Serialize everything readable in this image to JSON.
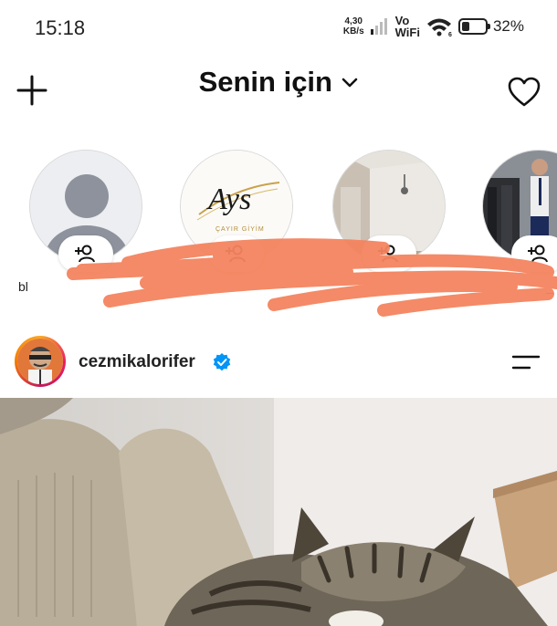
{
  "status_bar": {
    "time": "15:18",
    "net_speed_value": "4,30",
    "net_speed_unit": "KB/s",
    "wifi_line1": "Vo",
    "wifi_line2": "WiFi",
    "wifi_badge": "6",
    "battery_level": 0.32,
    "battery_pct": "32%"
  },
  "header": {
    "title": "Senin için",
    "icons": [
      "plus-icon",
      "chevron-down-icon",
      "heart-icon"
    ]
  },
  "suggestions": {
    "items": [
      {
        "avatar": "default-avatar",
        "name_visible": "bl"
      },
      {
        "avatar": "ays-logo",
        "logo_text": "Ays",
        "logo_subtext": "ÇAYIR GİYİM"
      },
      {
        "avatar": "room-photo"
      },
      {
        "avatar": "store-photo",
        "name_visible": "_"
      }
    ],
    "badge_icon": "add-person-icon"
  },
  "post": {
    "username": "cezmikalorifer",
    "verified": true,
    "icons": [
      "verified-badge-icon",
      "menu-icon"
    ]
  },
  "colors": {
    "accent_blue": "#0095f6",
    "scribble": "#f4845f"
  }
}
